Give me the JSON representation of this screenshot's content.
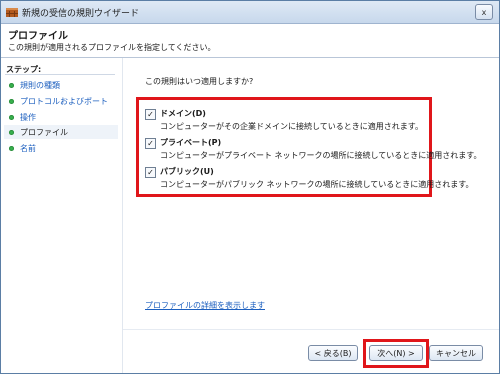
{
  "window": {
    "title": "新規の受信の規則ウイザード",
    "close_glyph": "x"
  },
  "header": {
    "title": "プロファイル",
    "description": "この規則が適用されるプロファイルを指定してください。"
  },
  "steps": {
    "heading": "ステップ:",
    "items": [
      {
        "label": "規則の種類"
      },
      {
        "label": "プロトコルおよびポート"
      },
      {
        "label": "操作"
      },
      {
        "label": "プロファイル"
      },
      {
        "label": "名前"
      }
    ]
  },
  "main": {
    "question": "この規則はいつ適用しますか?",
    "options": [
      {
        "label": "ドメイン(D)",
        "description": "コンピューターがその企業ドメインに接続しているときに適用されます。",
        "checked": true
      },
      {
        "label": "プライベート(P)",
        "description": "コンピューターがプライベート ネットワークの場所に接続しているときに適用されます。",
        "checked": true
      },
      {
        "label": "パブリック(U)",
        "description": "コンピューターがパブリック ネットワークの場所に接続しているときに適用されます。",
        "checked": true
      }
    ],
    "check_glyph": "✓",
    "link_text": "プロファイルの詳細を表示します"
  },
  "buttons": {
    "back": "< 戻る(B)",
    "next": "次へ(N) >",
    "cancel": "キャンセル"
  },
  "colors": {
    "highlight_red": "#e0161a",
    "link_blue": "#1c5fbf",
    "step_bullet": "#37b24d"
  }
}
